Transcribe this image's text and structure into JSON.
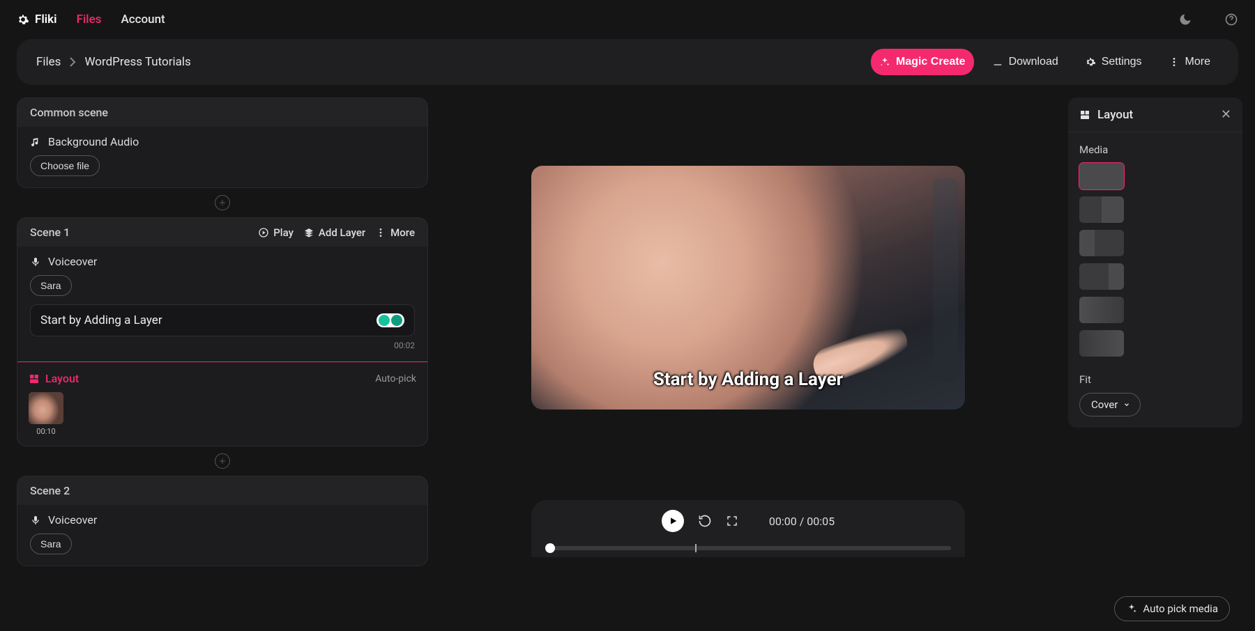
{
  "app": {
    "name": "Fliki"
  },
  "nav": {
    "files": "Files",
    "account": "Account"
  },
  "breadcrumb": {
    "root": "Files",
    "project": "WordPress Tutorials"
  },
  "toolbar": {
    "magic_create": "Magic Create",
    "download": "Download",
    "settings": "Settings",
    "more": "More"
  },
  "common_scene": {
    "title": "Common scene",
    "bg_audio_label": "Background Audio",
    "choose_file": "Choose file"
  },
  "scene1": {
    "title": "Scene 1",
    "play": "Play",
    "add_layer": "Add Layer",
    "more": "More",
    "voiceover_label": "Voiceover",
    "voice_name": "Sara",
    "script_text": "Start by Adding a Layer",
    "script_duration": "00:02",
    "layout_label": "Layout",
    "autopick": "Auto-pick",
    "clip_duration": "00:10"
  },
  "scene2": {
    "title": "Scene 2",
    "voiceover_label": "Voiceover",
    "voice_name": "Sara"
  },
  "preview": {
    "caption": "Start by Adding a Layer",
    "current_time": "00:00",
    "total_time": "00:05"
  },
  "layout_panel": {
    "title": "Layout",
    "media_label": "Media",
    "fit_label": "Fit",
    "fit_value": "Cover",
    "auto_pick": "Auto pick media"
  }
}
